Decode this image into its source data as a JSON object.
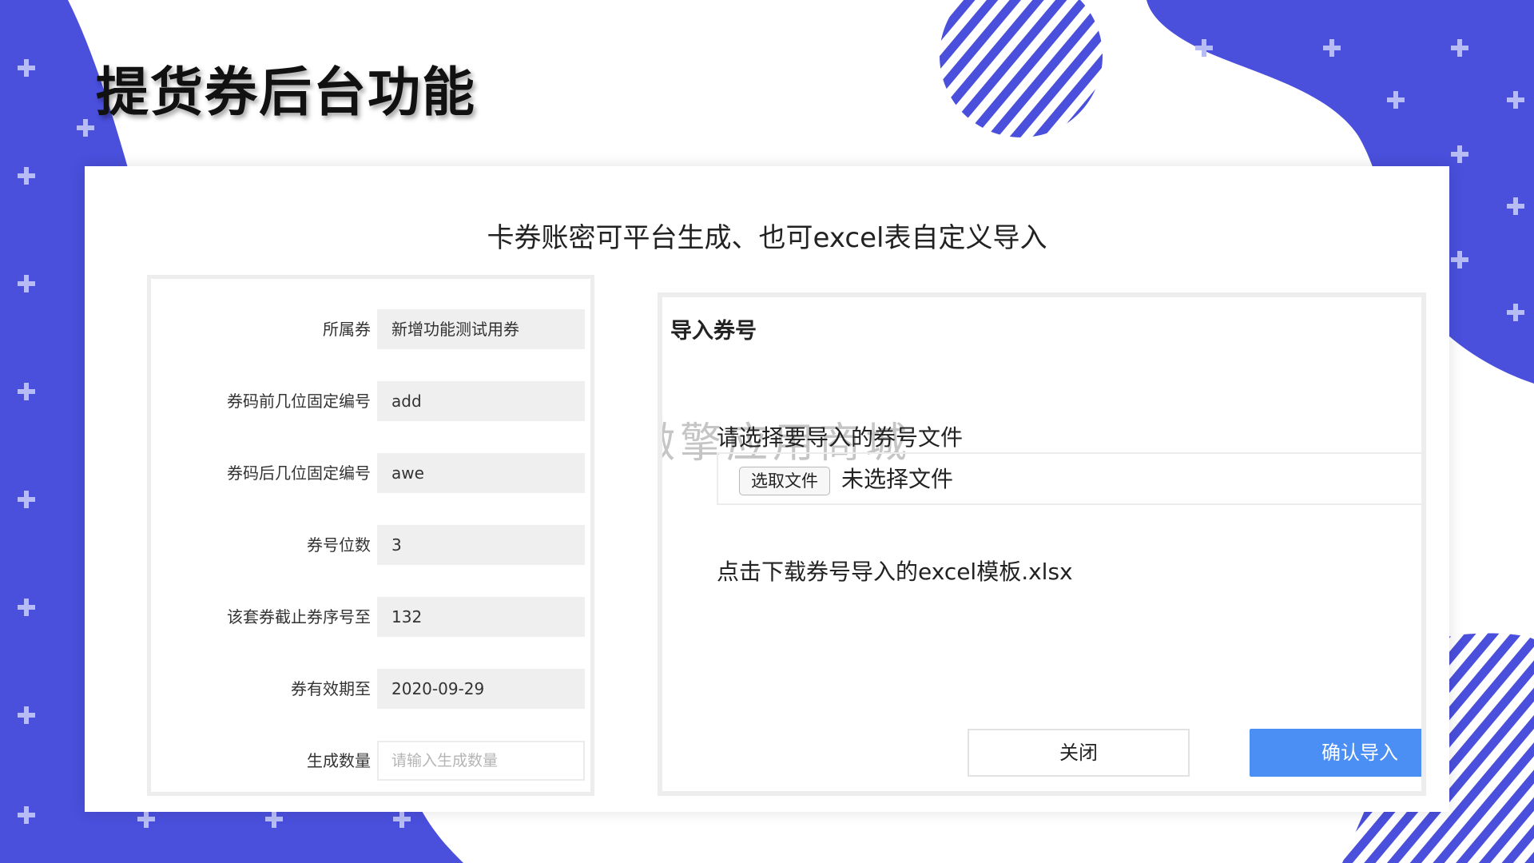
{
  "slide": {
    "title": "提货券后台功能",
    "subtitle": "卡券账密可平台生成、也可excel表自定义导入"
  },
  "theme": {
    "brand_blue": "#4a4fdc",
    "button_blue": "#4b8ef4",
    "field_gray": "#efefef"
  },
  "form": {
    "fields": [
      {
        "label": "所属券",
        "value": "新增功能测试用券"
      },
      {
        "label": "券码前几位固定编号",
        "value": "add"
      },
      {
        "label": "券码后几位固定编号",
        "value": "awe"
      },
      {
        "label": "券号位数",
        "value": "3"
      },
      {
        "label": "该套券截止券序号至",
        "value": "132"
      },
      {
        "label": "券有效期至",
        "value": "2020-09-29"
      }
    ],
    "quantity": {
      "label": "生成数量",
      "placeholder": "请输入生成数量",
      "value": ""
    }
  },
  "import_dialog": {
    "heading": "导入券号",
    "watermark": "微擎应用商城",
    "file_prompt": "请选择要导入的券号文件",
    "choose_file_button": "选取文件",
    "file_status": "未选择文件",
    "template_link": "点击下载券号导入的excel模板.xlsx",
    "close_button": "关闭",
    "confirm_button": "确认导入"
  }
}
